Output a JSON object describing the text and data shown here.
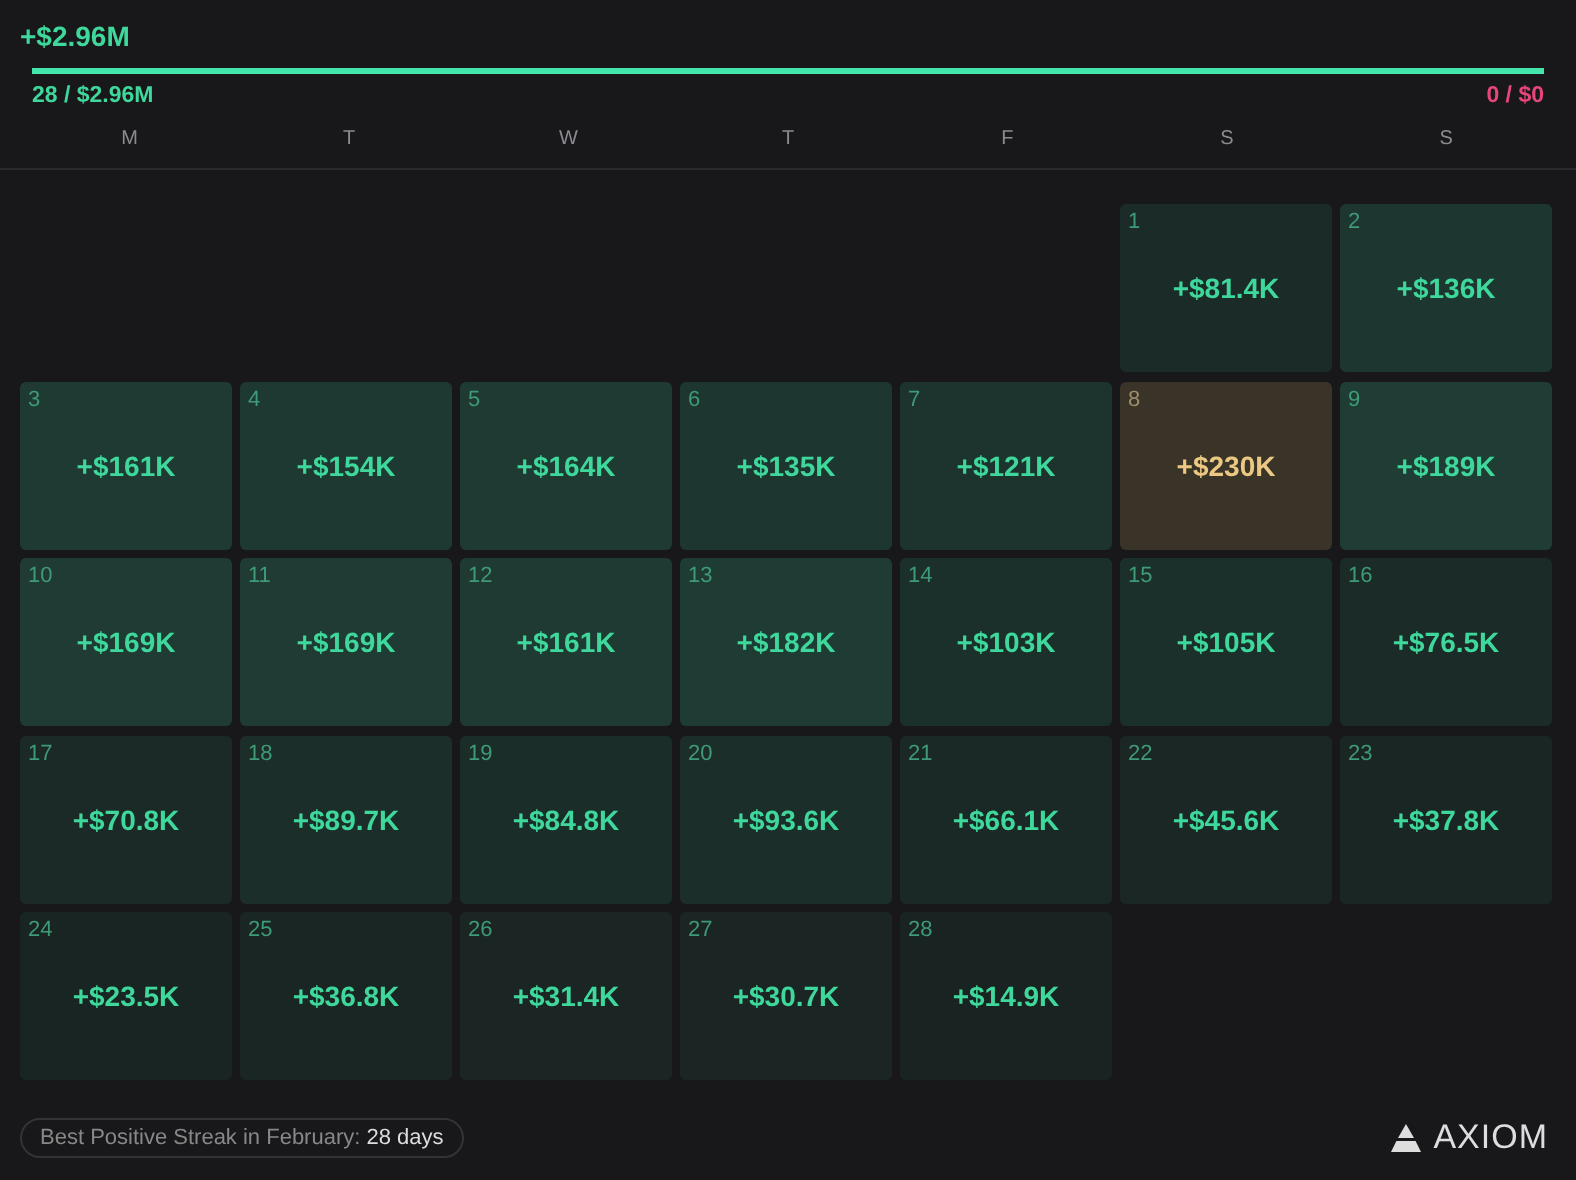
{
  "total": "+$2.96M",
  "progress": {
    "level": 1
  },
  "summary": {
    "positive": "28 / $2.96M",
    "negative": "0 / $0"
  },
  "weekdays": [
    "M",
    "T",
    "W",
    "T",
    "F",
    "S",
    "S"
  ],
  "weeks": [
    {
      "days": [
        {
          "day": "1",
          "pnl": "+$81.4K",
          "best": false,
          "color": "#1b2c28"
        },
        {
          "day": "2",
          "pnl": "+$136K",
          "best": false,
          "color": "#1e3630"
        }
      ]
    },
    {
      "days": [
        {
          "day": "3",
          "pnl": "+$161K",
          "best": false,
          "color": "#1f3a32"
        },
        {
          "day": "4",
          "pnl": "+$154K",
          "best": false,
          "color": "#1e3931"
        },
        {
          "day": "5",
          "pnl": "+$164K",
          "best": false,
          "color": "#1f3a32"
        },
        {
          "day": "6",
          "pnl": "+$135K",
          "best": false,
          "color": "#1e3630"
        },
        {
          "day": "7",
          "pnl": "+$121K",
          "best": false,
          "color": "#1d332e"
        },
        {
          "day": "8",
          "pnl": "+$230K",
          "best": true,
          "color": "#3a3328"
        },
        {
          "day": "9",
          "pnl": "+$189K",
          "best": false,
          "color": "#1f3d34"
        }
      ]
    },
    {
      "days": [
        {
          "day": "10",
          "pnl": "+$169K",
          "best": false,
          "color": "#1f3b33"
        },
        {
          "day": "11",
          "pnl": "+$169K",
          "best": false,
          "color": "#1f3b33"
        },
        {
          "day": "12",
          "pnl": "+$161K",
          "best": false,
          "color": "#1f3a32"
        },
        {
          "day": "13",
          "pnl": "+$182K",
          "best": false,
          "color": "#1f3c34"
        },
        {
          "day": "14",
          "pnl": "+$103K",
          "best": false,
          "color": "#1c302b"
        },
        {
          "day": "15",
          "pnl": "+$105K",
          "best": false,
          "color": "#1c302b"
        },
        {
          "day": "16",
          "pnl": "+$76.5K",
          "best": false,
          "color": "#1b2b27"
        }
      ]
    },
    {
      "days": [
        {
          "day": "17",
          "pnl": "+$70.8K",
          "best": false,
          "color": "#1b2a27"
        },
        {
          "day": "18",
          "pnl": "+$89.7K",
          "best": false,
          "color": "#1c2e29"
        },
        {
          "day": "19",
          "pnl": "+$84.8K",
          "best": false,
          "color": "#1b2d28"
        },
        {
          "day": "20",
          "pnl": "+$93.6K",
          "best": false,
          "color": "#1c2e2a"
        },
        {
          "day": "21",
          "pnl": "+$66.1K",
          "best": false,
          "color": "#1a2926"
        },
        {
          "day": "22",
          "pnl": "+$45.6K",
          "best": false,
          "color": "#1a2725"
        },
        {
          "day": "23",
          "pnl": "+$37.8K",
          "best": false,
          "color": "#1a2624"
        }
      ]
    },
    {
      "days": [
        {
          "day": "24",
          "pnl": "+$23.5K",
          "best": false,
          "color": "#192523"
        },
        {
          "day": "25",
          "pnl": "+$36.8K",
          "best": false,
          "color": "#1a2624"
        },
        {
          "day": "26",
          "pnl": "+$31.4K",
          "best": false,
          "color": "#1a2524"
        },
        {
          "day": "27",
          "pnl": "+$30.7K",
          "best": false,
          "color": "#1a2524"
        },
        {
          "day": "28",
          "pnl": "+$14.9K",
          "best": false,
          "color": "#192422"
        }
      ]
    }
  ],
  "footer": {
    "streak": "Best Positive Streak in February: **28 days**",
    "logo": "AXIOM"
  }
}
